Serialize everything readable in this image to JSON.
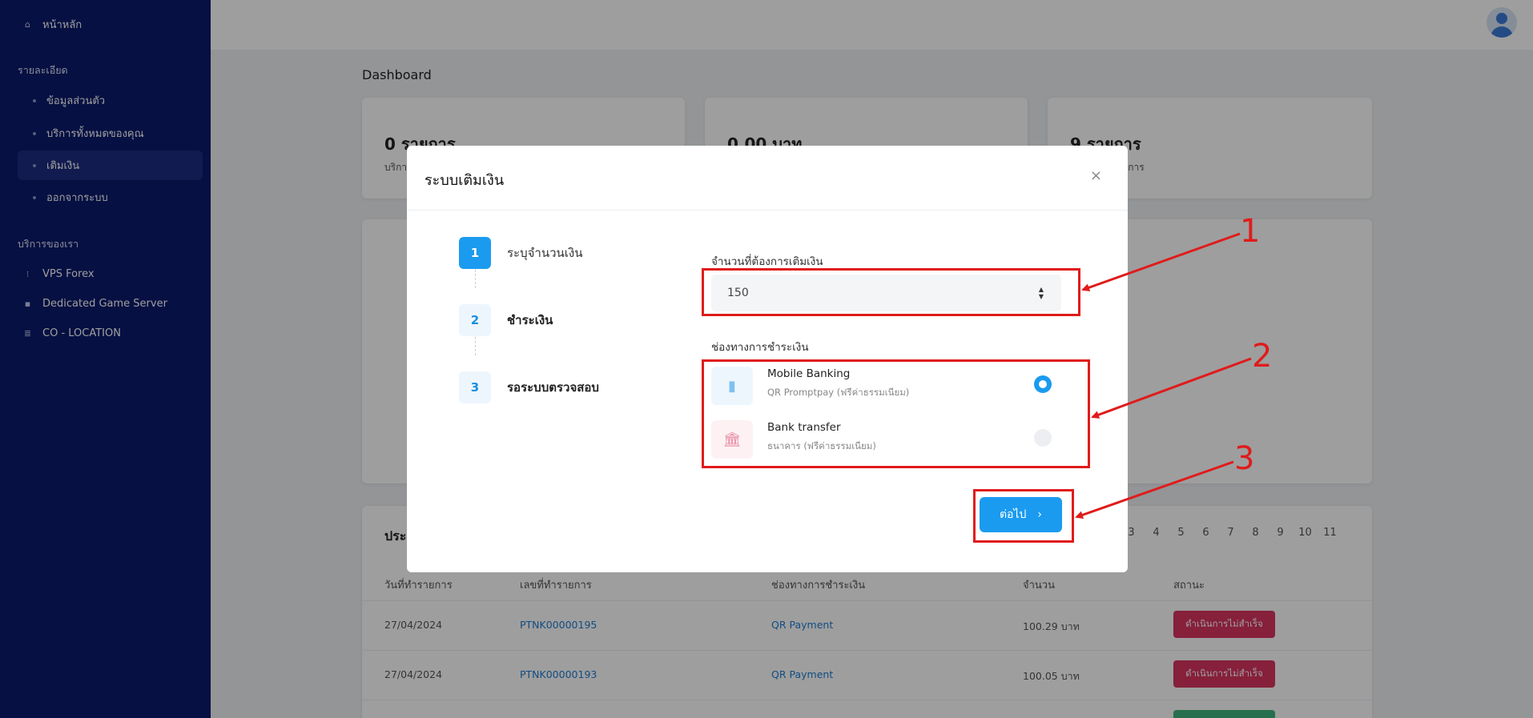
{
  "sidebar": {
    "home": "หน้าหลัก",
    "section_details": "รายละเอียด",
    "items": [
      {
        "label": "ข้อมูลส่วนตัว"
      },
      {
        "label": "บริการทั้งหมดของคุณ"
      },
      {
        "label": "เติมเงิน"
      },
      {
        "label": "ออกจากระบบ"
      }
    ],
    "section_services": "บริการของเรา",
    "services": [
      {
        "label": "VPS Forex"
      },
      {
        "label": "Dedicated Game Server"
      },
      {
        "label": "CO - LOCATION"
      }
    ]
  },
  "main": {
    "title": "Dashboard",
    "cards": [
      {
        "value": "0 รายการ",
        "sub": "บริการ"
      },
      {
        "value": "0.00 บาท",
        "sub": ""
      },
      {
        "value": "9 รายการ",
        "sub": "รายการ"
      }
    ],
    "history": {
      "title": "ประ",
      "pages": [
        "3",
        "4",
        "5",
        "6",
        "7",
        "8",
        "9",
        "10",
        "11"
      ],
      "headers": [
        "วันที่ทำรายการ",
        "เลขที่ทำรายการ",
        "ช่องทางการชำระเงิน",
        "จำนวน",
        "สถานะ"
      ],
      "rows": [
        {
          "date": "27/04/2024",
          "id": "PTNK00000195",
          "method": "QR Payment",
          "amount": "100.29 บาท",
          "status": "ดำเนินการไม่สำเร็จ"
        },
        {
          "date": "27/04/2024",
          "id": "PTNK00000193",
          "method": "QR Payment",
          "amount": "100.05 บาท",
          "status": "ดำเนินการไม่สำเร็จ"
        }
      ]
    }
  },
  "modal": {
    "title": "ระบบเติมเงิน",
    "close": "×",
    "steps": [
      {
        "num": "1",
        "label": "ระบุจำนวนเงิน"
      },
      {
        "num": "2",
        "label": "ชำระเงิน"
      },
      {
        "num": "3",
        "label": "รอระบบตรวจสอบ"
      }
    ],
    "amount_label": "จำนวนที่ต้องการเติมเงิน",
    "amount_value": "150",
    "payment_label": "ช่องทางการชำระเงิน",
    "payment_options": [
      {
        "name": "Mobile Banking",
        "desc": "QR Promptpay (ฟรีค่าธรรมเนียม)",
        "selected": true,
        "icon": "phone-icon"
      },
      {
        "name": "Bank transfer",
        "desc": "ธนาคาร (ฟรีค่าธรรมเนียม)",
        "selected": false,
        "icon": "bank-icon"
      }
    ],
    "next_label": "ต่อไป"
  },
  "annotations": [
    "1",
    "2",
    "3"
  ],
  "colors": {
    "sidebar": "#0a1a6b",
    "primary": "#1a9bf0",
    "annotation": "#e01b1b",
    "danger": "#d9345f"
  }
}
